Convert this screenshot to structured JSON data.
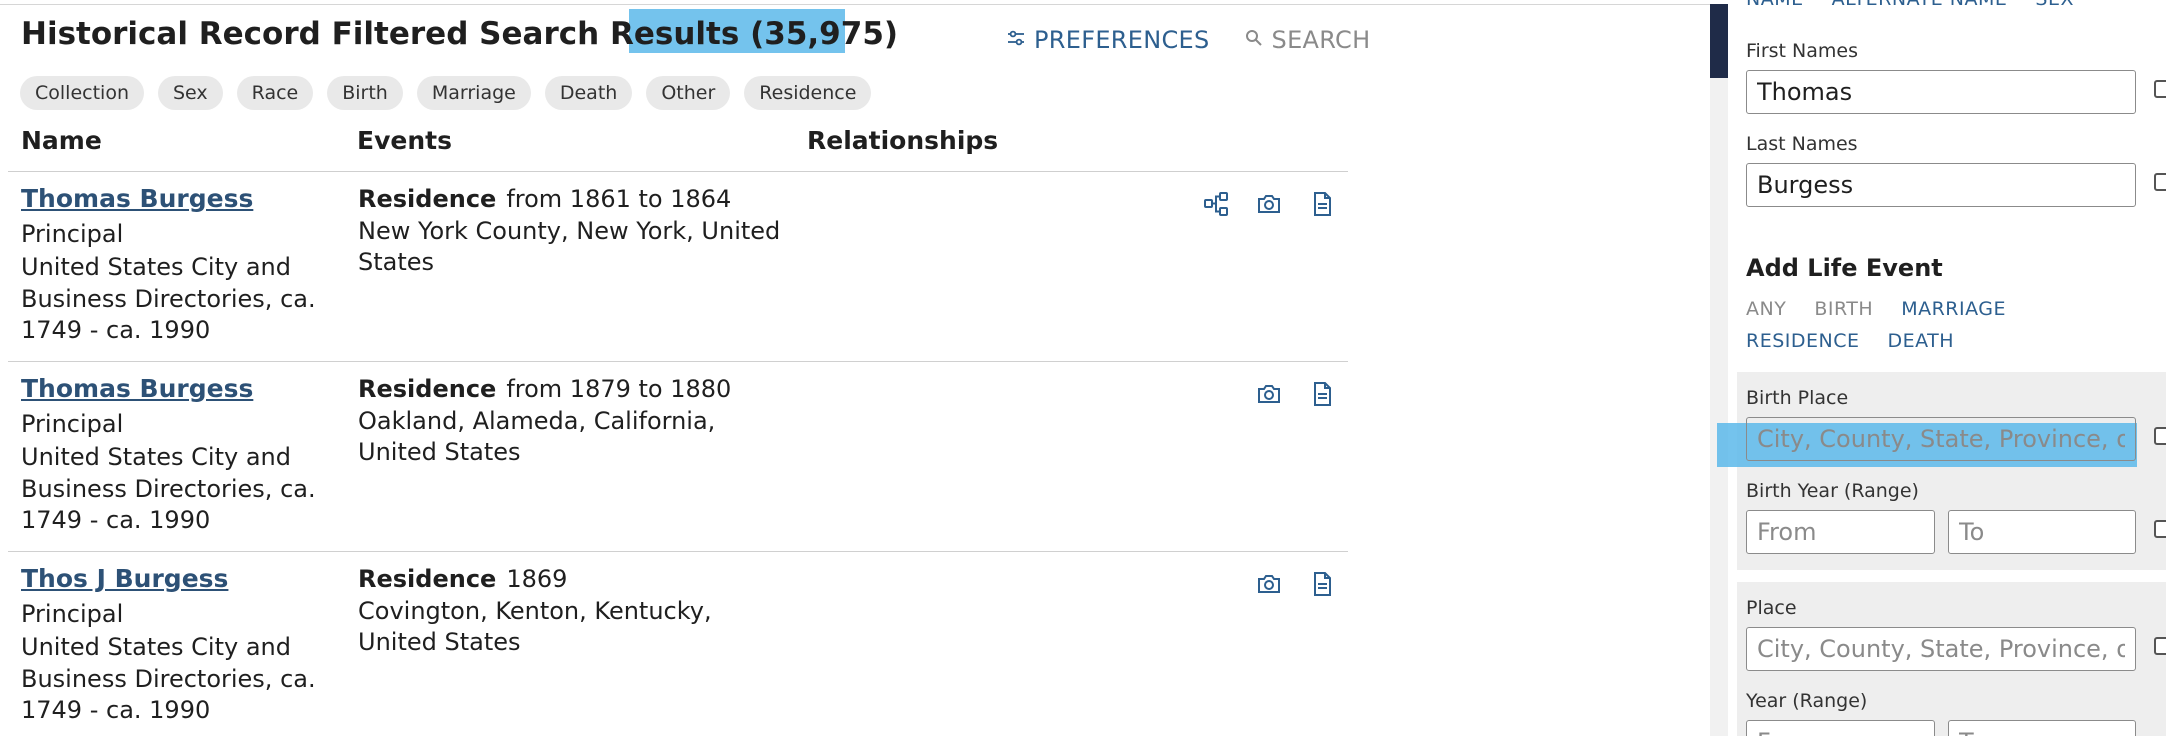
{
  "results": {
    "title_prefix": "Historical Record Filtered Search Results",
    "count": "(35,975)",
    "preferences_label": "PREFERENCES",
    "search_label": "SEARCH",
    "filter_chips": [
      "Collection",
      "Sex",
      "Race",
      "Birth",
      "Marriage",
      "Death",
      "Other",
      "Residence"
    ],
    "columns": {
      "name": "Name",
      "events": "Events",
      "relationships": "Relationships"
    },
    "rows": [
      {
        "name": "Thomas Burgess",
        "role": "Principal",
        "collection": "United States City and Business Directories, ca. 1749 - ca. 1990",
        "event_type": "Residence",
        "event_date": "from 1861 to 1864",
        "event_place": "New York County, New York, United States",
        "has_tree_icon": true
      },
      {
        "name": "Thomas Burgess",
        "role": "Principal",
        "collection": "United States City and Business Directories, ca. 1749 - ca. 1990",
        "event_type": "Residence",
        "event_date": "from 1879 to 1880",
        "event_place": "Oakland, Alameda, California, United States",
        "has_tree_icon": false
      },
      {
        "name": "Thos J Burgess",
        "role": "Principal",
        "collection": "United States City and Business Directories, ca. 1749 - ca. 1990",
        "event_type": "Residence",
        "event_date": "1869",
        "event_place": "Covington, Kenton, Kentucky, United States",
        "has_tree_icon": false
      }
    ]
  },
  "sidebar": {
    "top_tabs": [
      "NAME",
      "ALTERNATE NAME",
      "SEX"
    ],
    "first_names_label": "First Names",
    "first_names_value": "Thomas",
    "last_names_label": "Last Names",
    "last_names_value": "Burgess",
    "add_life_event_title": "Add Life Event",
    "event_tabs": [
      {
        "label": "ANY",
        "state": "muted"
      },
      {
        "label": "BIRTH",
        "state": "muted"
      },
      {
        "label": "MARRIAGE",
        "state": "active"
      },
      {
        "label": "RESIDENCE",
        "state": "active"
      },
      {
        "label": "DEATH",
        "state": "active"
      }
    ],
    "birth_place_label": "Birth Place",
    "birth_place_placeholder": "City, County, State, Province, or Country",
    "birth_year_label": "Birth Year (Range)",
    "from_placeholder": "From",
    "to_placeholder": "To",
    "place_label": "Place",
    "place_placeholder": "City, County, State, Province, or Country",
    "year_label": "Year (Range)"
  },
  "colors": {
    "link": "#2d5176",
    "accent": "#2d5f8f",
    "highlight": "#5cb8ea",
    "dark_bar": "#1f2b48"
  }
}
